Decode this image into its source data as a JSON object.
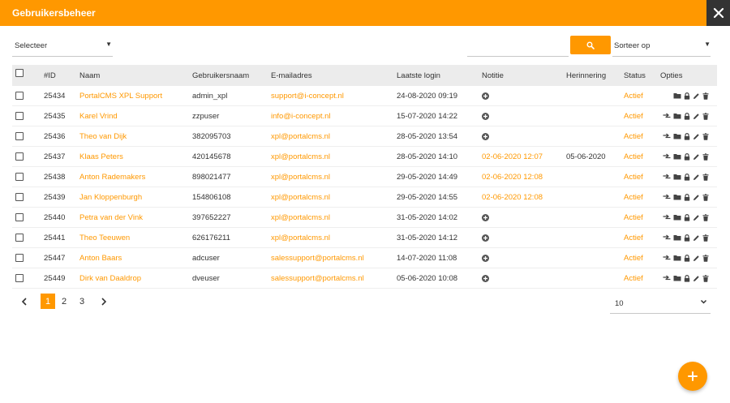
{
  "header": {
    "title": "Gebruikersbeheer"
  },
  "filters": {
    "select_label": "Selecteer",
    "sort_label": "Sorteer op"
  },
  "table": {
    "headers": {
      "id": "#ID",
      "name": "Naam",
      "username": "Gebruikersnaam",
      "email": "E-mailadres",
      "last_login": "Laatste login",
      "note": "Notitie",
      "reminder": "Herinnering",
      "status": "Status",
      "options": "Opties"
    },
    "rows": [
      {
        "id": "25434",
        "name": "PortalCMS XPL Support",
        "username": "admin_xpl",
        "email": "support@i-concept.nl",
        "last_login": "24-08-2020 09:19",
        "note": "",
        "reminder": "",
        "status": "Actief"
      },
      {
        "id": "25435",
        "name": "Karel Vrind",
        "username": "zzpuser",
        "email": "info@i-concept.nl",
        "last_login": "15-07-2020 14:22",
        "note": "",
        "reminder": "",
        "status": "Actief"
      },
      {
        "id": "25436",
        "name": "Theo van Dijk",
        "username": "382095703",
        "email": "xpl@portalcms.nl",
        "last_login": "28-05-2020 13:54",
        "note": "",
        "reminder": "",
        "status": "Actief"
      },
      {
        "id": "25437",
        "name": "Klaas Peters",
        "username": "420145678",
        "email": "xpl@portalcms.nl",
        "last_login": "28-05-2020 14:10",
        "note": "02-06-2020 12:07",
        "reminder": "05-06-2020",
        "status": "Actief"
      },
      {
        "id": "25438",
        "name": "Anton Rademakers",
        "username": "898021477",
        "email": "xpl@portalcms.nl",
        "last_login": "29-05-2020 14:49",
        "note": "02-06-2020 12:08",
        "reminder": "",
        "status": "Actief"
      },
      {
        "id": "25439",
        "name": "Jan Kloppenburgh",
        "username": "154806108",
        "email": "xpl@portalcms.nl",
        "last_login": "29-05-2020 14:55",
        "note": "02-06-2020 12:08",
        "reminder": "",
        "status": "Actief"
      },
      {
        "id": "25440",
        "name": "Petra van der Vink",
        "username": "397652227",
        "email": "xpl@portalcms.nl",
        "last_login": "31-05-2020 14:02",
        "note": "",
        "reminder": "",
        "status": "Actief"
      },
      {
        "id": "25441",
        "name": "Theo Teeuwen",
        "username": "626176211",
        "email": "xpl@portalcms.nl",
        "last_login": "31-05-2020 14:12",
        "note": "",
        "reminder": "",
        "status": "Actief"
      },
      {
        "id": "25447",
        "name": "Anton Baars",
        "username": "adcuser",
        "email": "salessupport@portalcms.nl",
        "last_login": "14-07-2020 11:08",
        "note": "",
        "reminder": "",
        "status": "Actief"
      },
      {
        "id": "25449",
        "name": "Dirk van Daaldrop",
        "username": "dveuser",
        "email": "salessupport@portalcms.nl",
        "last_login": "05-06-2020 10:08",
        "note": "",
        "reminder": "",
        "status": "Actief"
      }
    ]
  },
  "pagination": {
    "pages": [
      "1",
      "2",
      "3"
    ],
    "active_page": "1",
    "per_page": "10"
  },
  "colors": {
    "accent": "#ff9800",
    "header_bg": "#ff9800",
    "close_bg": "#333333",
    "table_header_bg": "#ececec"
  },
  "icons": {
    "close": "close-icon",
    "search": "search-icon",
    "note_add": "add-note-icon",
    "option_icons": [
      "login-as-icon",
      "folder-icon",
      "lock-icon",
      "edit-icon",
      "delete-icon"
    ],
    "fab": "plus-icon"
  }
}
